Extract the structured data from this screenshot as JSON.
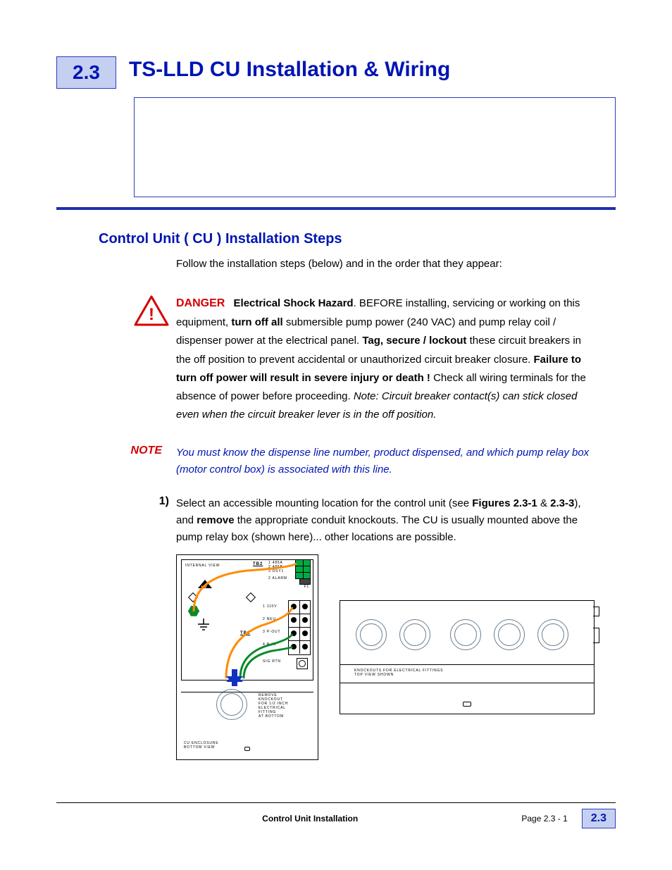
{
  "section_number": "2.3",
  "main_title": "TS-LLD CU Installation & Wiring",
  "subheading": "Control Unit ( CU ) Installation Steps",
  "intro_line": "Follow the installation steps (below) and in the order that they appear:",
  "danger": {
    "label": "DANGER",
    "hazard_bold": "Electrical Shock Hazard",
    "text1_a": ". BEFORE installing, servicing or working on this equipment, ",
    "bold1": "turn off all",
    "text1_b": " submersible pump power (240 VAC) and pump relay coil / dispenser power at the electrical panel. ",
    "bold2": "Tag, secure / lockout",
    "text1_c": " these circuit breakers in the off position to prevent accidental or unauthorized circuit breaker closure.  ",
    "bold3": "Failure to turn off power will result in severe injury or death !",
    "text1_d": "   Check all wiring terminals for the absence of power before proceeding. ",
    "italic_note": "Note: Circuit breaker contact(s) can stick closed even when the circuit breaker lever is in the off position."
  },
  "note": {
    "label": "NOTE",
    "body": "You must know the dispense line number, product dispensed, and which pump relay box (motor control box) is associated with this line."
  },
  "step1": {
    "num": "1)",
    "a": "Select an accessible mounting location for the control unit (see ",
    "bold1": "Figures 2.3-1",
    "amp": " & ",
    "bold2": "2.3-3",
    "b": "), and ",
    "bold3": "remove",
    "c": " the appropriate conduit knockouts. The CU is usually mounted above the pump relay box (shown here)... other locations are possible."
  },
  "figure_left": {
    "title": "INTERNAL VIEW",
    "tb2": "TB2",
    "tb1": "TB1",
    "tb2_pins": [
      "1  485A",
      "2  485B",
      "3  DSY1"
    ],
    "fuse": "F1",
    "alarm": "2  ALARM",
    "tb1_pins": [
      "1  110V",
      "2  NEU",
      "3  P-OUT",
      "4  P-IN",
      "SIG RTN"
    ],
    "up": "UP",
    "bottom_caption": "CU ENCLOSURE\nBOTTOM VIEW",
    "knockout_note": "REMOVE\nKNOCKOUT\nFOR 1/2 INCH\nELECTRICAL\nFITTING\nAT BOTTOM"
  },
  "figure_right": {
    "caption": "KNOCKOUTS FOR ELECTRICAL FITTINGS\nTOP VIEW SHOWN"
  },
  "footer": {
    "center": "Control Unit Installation",
    "page_label": "Page   2.3 - 1",
    "badge": "2.3"
  }
}
